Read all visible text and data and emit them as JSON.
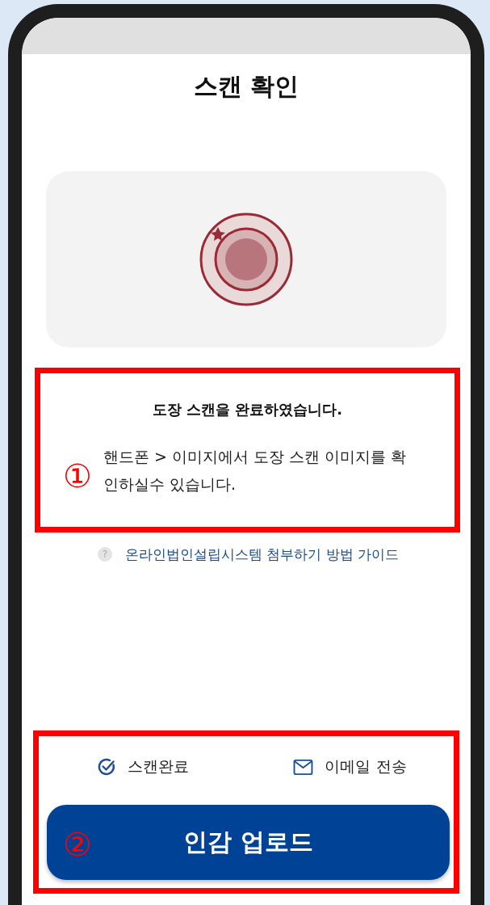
{
  "screen": {
    "title": "스캔 확인"
  },
  "message": {
    "title": "도장 스캔을 완료하였습니다.",
    "body": "핸드폰 > 이미지에서 도장 스캔 이미지를 확인하실수 있습니다.",
    "annotation": "①"
  },
  "guide_link": {
    "icon": "?",
    "label": "온라인법인설립시스템 첨부하기 방법 가이드"
  },
  "actions": {
    "annotation": "②",
    "status_items": [
      {
        "kind": "check",
        "label": "스캔완료"
      },
      {
        "kind": "mail",
        "label": "이메일 전송"
      }
    ],
    "primary_button": "인감 업로드"
  }
}
